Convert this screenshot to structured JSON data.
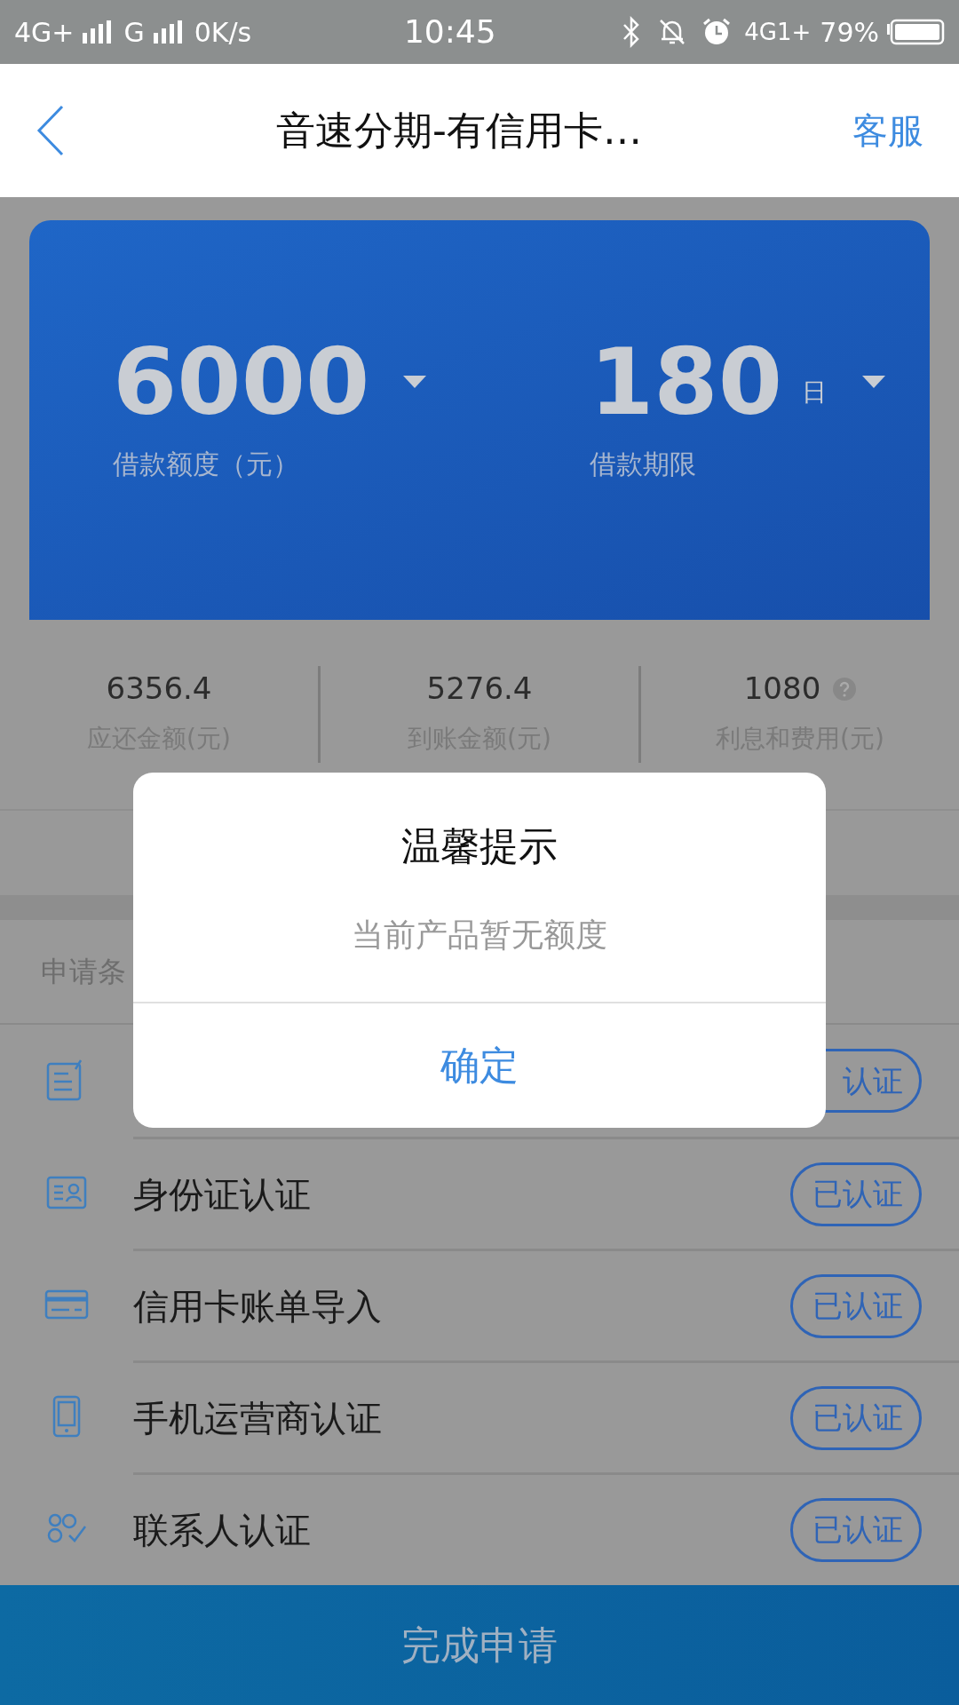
{
  "status_bar": {
    "network_1": "4G+",
    "network_2": "G",
    "speed": "0K/s",
    "time": "10:45",
    "network_3": "4G1+",
    "battery": "79%"
  },
  "header": {
    "title": "音速分期-有信用卡…",
    "service": "客服"
  },
  "loan_card": {
    "amount": {
      "value": "6000",
      "label": "借款额度（元）"
    },
    "term": {
      "value": "180",
      "unit": "日",
      "label": "借款期限"
    }
  },
  "stats": [
    {
      "value": "6356.4",
      "label": "应还金额(元)",
      "help": false
    },
    {
      "value": "5276.4",
      "label": "到账金额(元)",
      "help": false
    },
    {
      "value": "1080",
      "label": "利息和费用(元)",
      "help": true
    }
  ],
  "section": {
    "title": "申请条"
  },
  "conditions": [
    {
      "kind": "form",
      "badge": "认证"
    },
    {
      "kind": "id_card",
      "label": "身份证认证",
      "badge": "已认证"
    },
    {
      "kind": "credit_card",
      "label": "信用卡账单导入",
      "badge": "已认证"
    },
    {
      "kind": "phone",
      "label": "手机运营商认证",
      "badge": "已认证"
    },
    {
      "kind": "contacts",
      "label": "联系人认证",
      "badge": "已认证"
    }
  ],
  "submit_button": "完成申请",
  "dialog": {
    "title": "温馨提示",
    "message": "当前产品暂无额度",
    "button": "确定"
  }
}
